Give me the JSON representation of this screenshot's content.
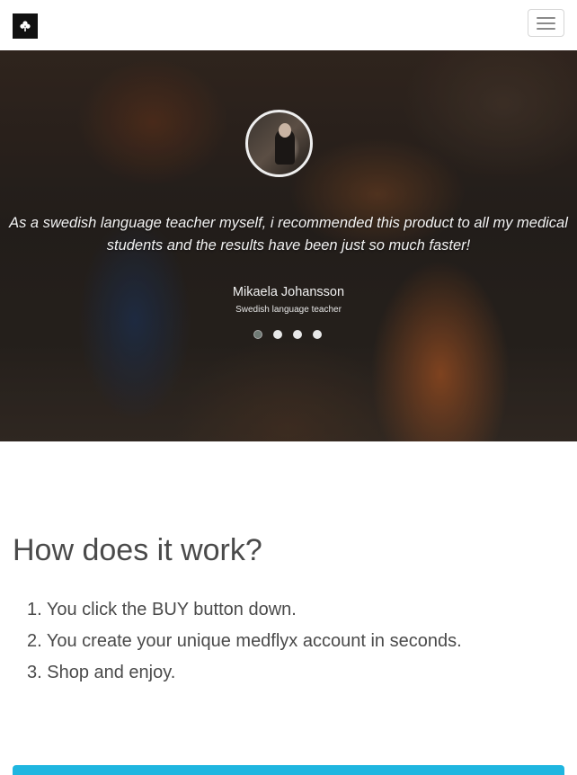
{
  "navbar": {
    "logo_icon": "clover-logo-icon",
    "menu_icon": "hamburger-menu-icon"
  },
  "testimonial": {
    "quote": "As a swedish language teacher myself, i recommended this product to all my medical students and the results have been just so much faster!",
    "author": "Mikaela Johansson",
    "role": "Swedish language teacher",
    "carousel_slides": 4,
    "active_slide": 1
  },
  "how": {
    "title": "How does it work?",
    "steps": [
      "1. You click the BUY button down.",
      "2. You create your unique medflyx account in seconds.",
      "3. Shop and enjoy."
    ]
  },
  "colors": {
    "accent": "#1fb6e0",
    "heading": "#4a4a4a"
  }
}
